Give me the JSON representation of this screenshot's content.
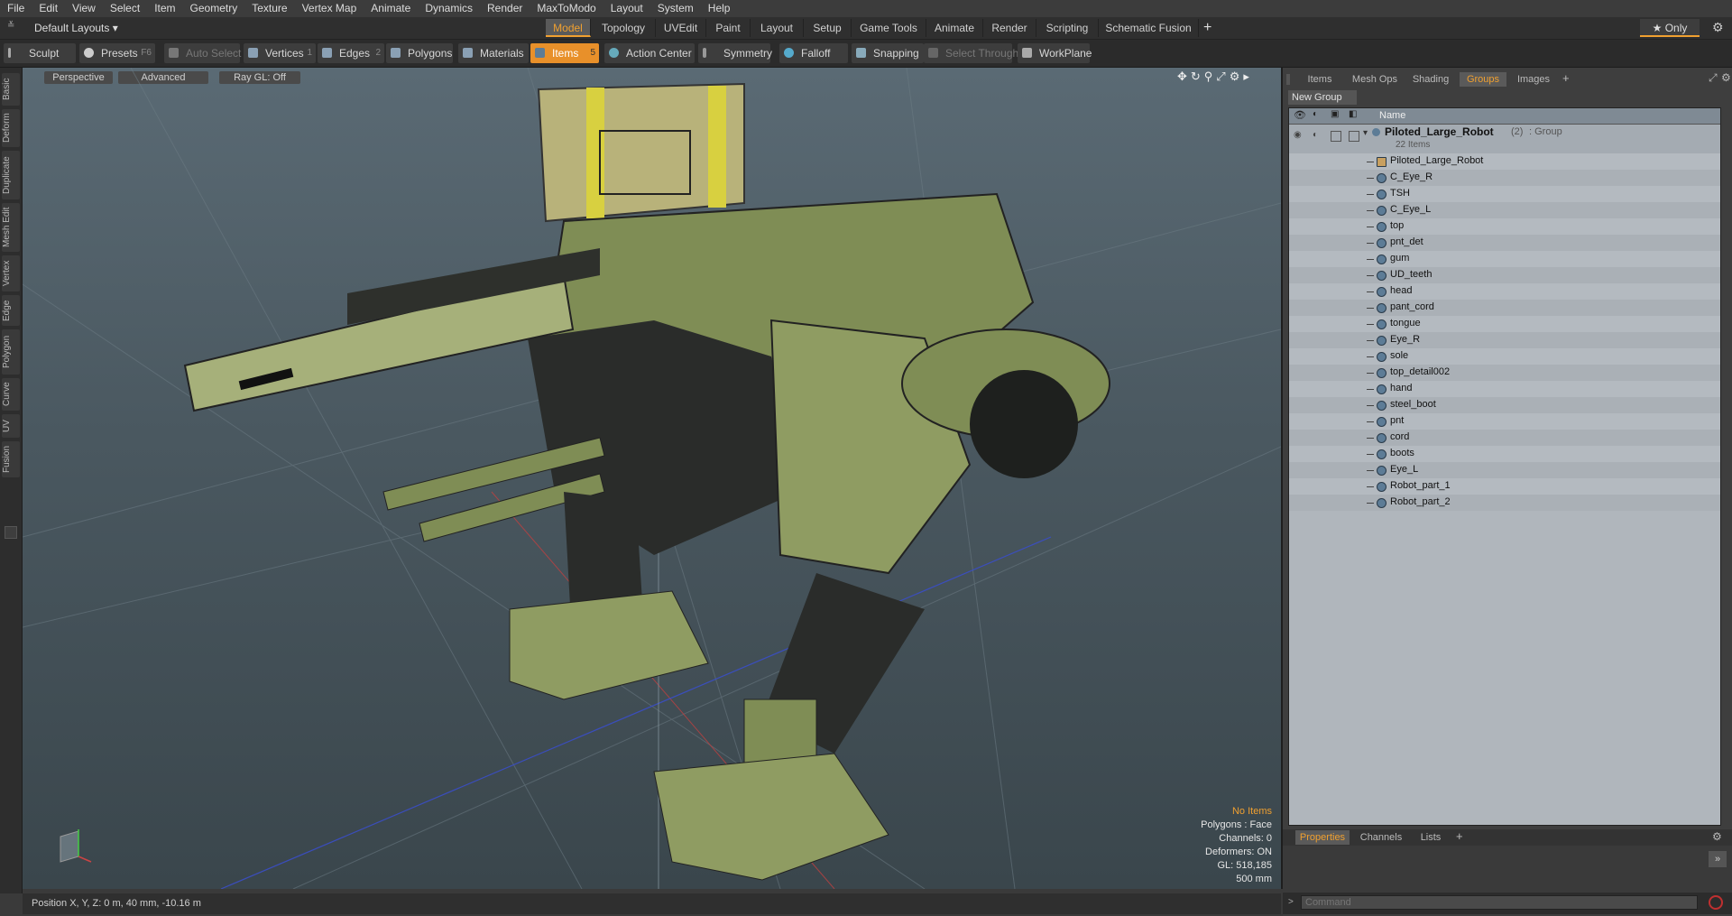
{
  "menu": [
    "File",
    "Edit",
    "View",
    "Select",
    "Item",
    "Geometry",
    "Texture",
    "Vertex Map",
    "Animate",
    "Dynamics",
    "Render",
    "MaxToModo",
    "Layout",
    "System",
    "Help"
  ],
  "layout_selector": "Default Layouts ▾",
  "layout_tabs": [
    "Model",
    "Topology",
    "UVEdit",
    "Paint",
    "Layout",
    "Setup",
    "Game Tools",
    "Animate",
    "Render",
    "Scripting",
    "Schematic Fusion"
  ],
  "layout_tabs_active": "Model",
  "only_label": "★  Only",
  "toolbar": {
    "sculpt": "Sculpt",
    "presets": "Presets",
    "presets_key": "F6",
    "auto_select": "Auto Select",
    "vertices": "Vertices",
    "vertices_key": "1",
    "edges": "Edges",
    "edges_key": "2",
    "polygons": "Polygons",
    "materials": "Materials",
    "items": "Items",
    "items_key": "5",
    "action_center": "Action Center",
    "symmetry": "Symmetry",
    "falloff": "Falloff",
    "snapping": "Snapping",
    "select_through": "Select Through",
    "workplane": "WorkPlane"
  },
  "left_tabs": [
    "Basic",
    "Deform",
    "Duplicate",
    "Mesh Edit",
    "Vertex",
    "Edge",
    "Polygon",
    "Curve",
    "UV",
    "Fusion"
  ],
  "viewport": {
    "view": "Perspective",
    "shading": "Advanced",
    "raygl": "Ray GL: Off",
    "stats": [
      "No Items",
      "Polygons : Face",
      "Channels: 0",
      "Deformers: ON",
      "GL: 518,185",
      "500 mm"
    ]
  },
  "right_tabs": [
    "Items",
    "Mesh Ops",
    "Shading",
    "Groups",
    "Images"
  ],
  "right_tabs_active": "Groups",
  "new_group": "New Group",
  "col_name": "Name",
  "group": {
    "name": "Piloted_Large_Robot",
    "count": "(2)",
    "type": ": Group",
    "items_count": "22 Items"
  },
  "items": [
    "Piloted_Large_Robot",
    "C_Eye_R",
    "TSH",
    "C_Eye_L",
    "top",
    "pnt_det",
    "gum",
    "UD_teeth",
    "head",
    "pant_cord",
    "tongue",
    "Eye_R",
    "sole",
    "top_detail002",
    "hand",
    "steel_boot",
    "pnt",
    "cord",
    "boots",
    "Eye_L",
    "Robot_part_1",
    "Robot_part_2"
  ],
  "bottom_tabs": [
    "Properties",
    "Channels",
    "Lists"
  ],
  "bottom_tabs_active": "Properties",
  "status_position": "Position X, Y, Z:   0 m, 40 mm, -10.16 m",
  "command_placeholder": "Command",
  "colors": {
    "accent": "#f0a030",
    "panel": "#3e3e3e",
    "list_bg": "#b0b6bc",
    "robot_green": "#8a9a5a"
  }
}
